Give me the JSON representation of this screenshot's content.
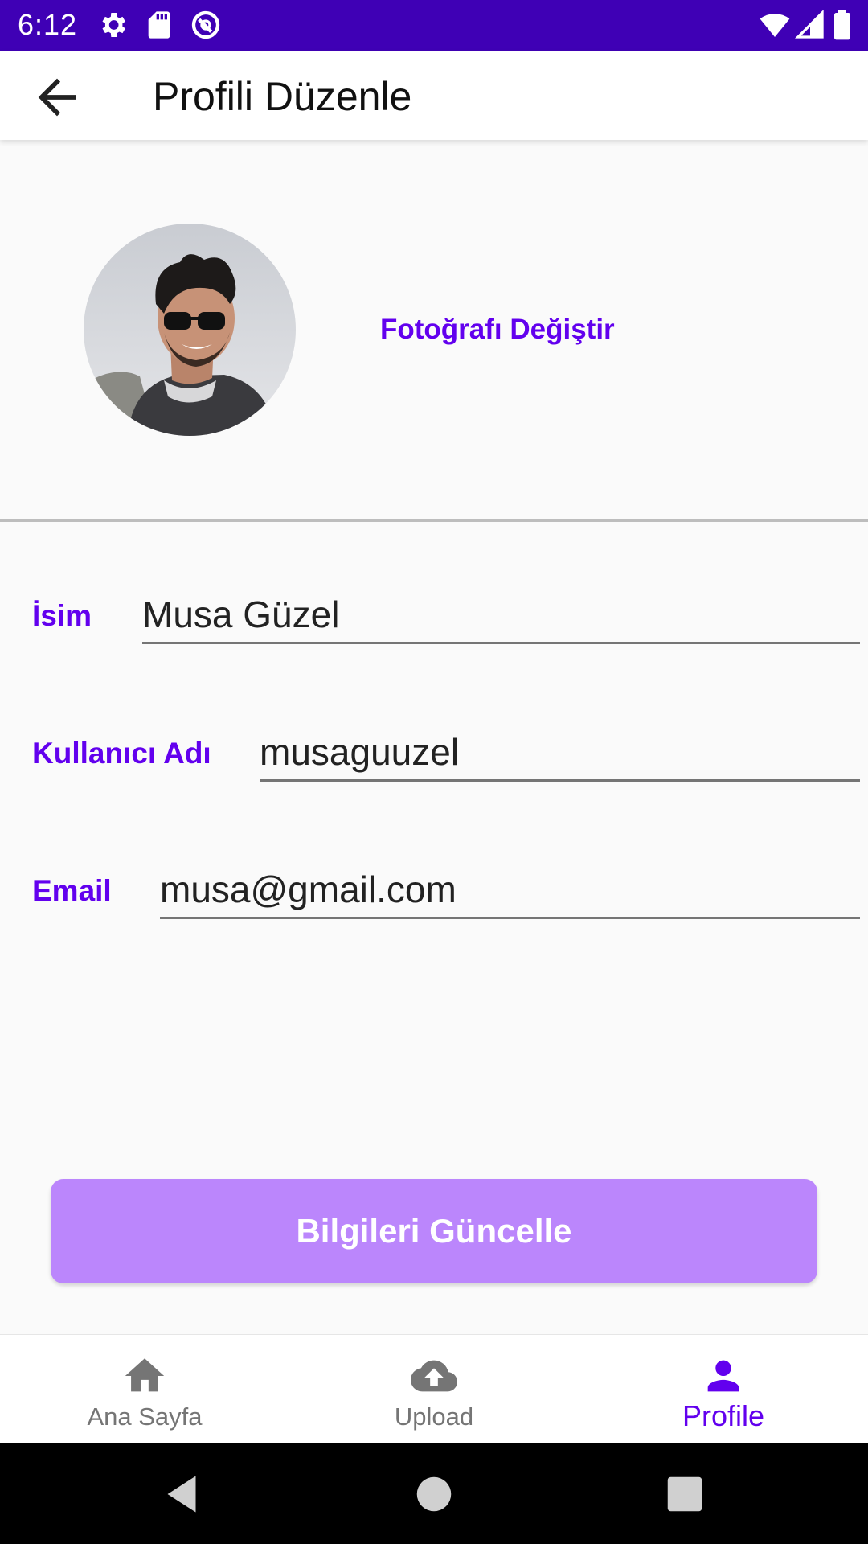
{
  "status_bar": {
    "time": "6:12",
    "icons": [
      "settings-icon",
      "sd-card-icon",
      "vpn-icon",
      "wifi-icon",
      "signal-icon",
      "battery-icon"
    ]
  },
  "app_bar": {
    "title": "Profili Düzenle",
    "back_icon": "arrow-back-icon"
  },
  "profile": {
    "change_photo_label": "Fotoğrafı Değiştir"
  },
  "form": {
    "name_label": "İsim",
    "name_value": "Musa Güzel",
    "username_label": "Kullanıcı Adı",
    "username_value": "musaguuzel",
    "email_label": "Email",
    "email_value": "musa@gmail.com"
  },
  "update_button_label": "Bilgileri Güncelle",
  "bottom_nav": {
    "items": [
      {
        "label": "Ana Sayfa",
        "icon": "home-icon",
        "active": false
      },
      {
        "label": "Upload",
        "icon": "cloud-upload-icon",
        "active": false
      },
      {
        "label": "Profile",
        "icon": "person-icon",
        "active": true
      }
    ]
  },
  "colors": {
    "status_bar": "#3f00b5",
    "accent": "#6200ee",
    "button": "#bb86fc",
    "inactive": "#757575"
  }
}
